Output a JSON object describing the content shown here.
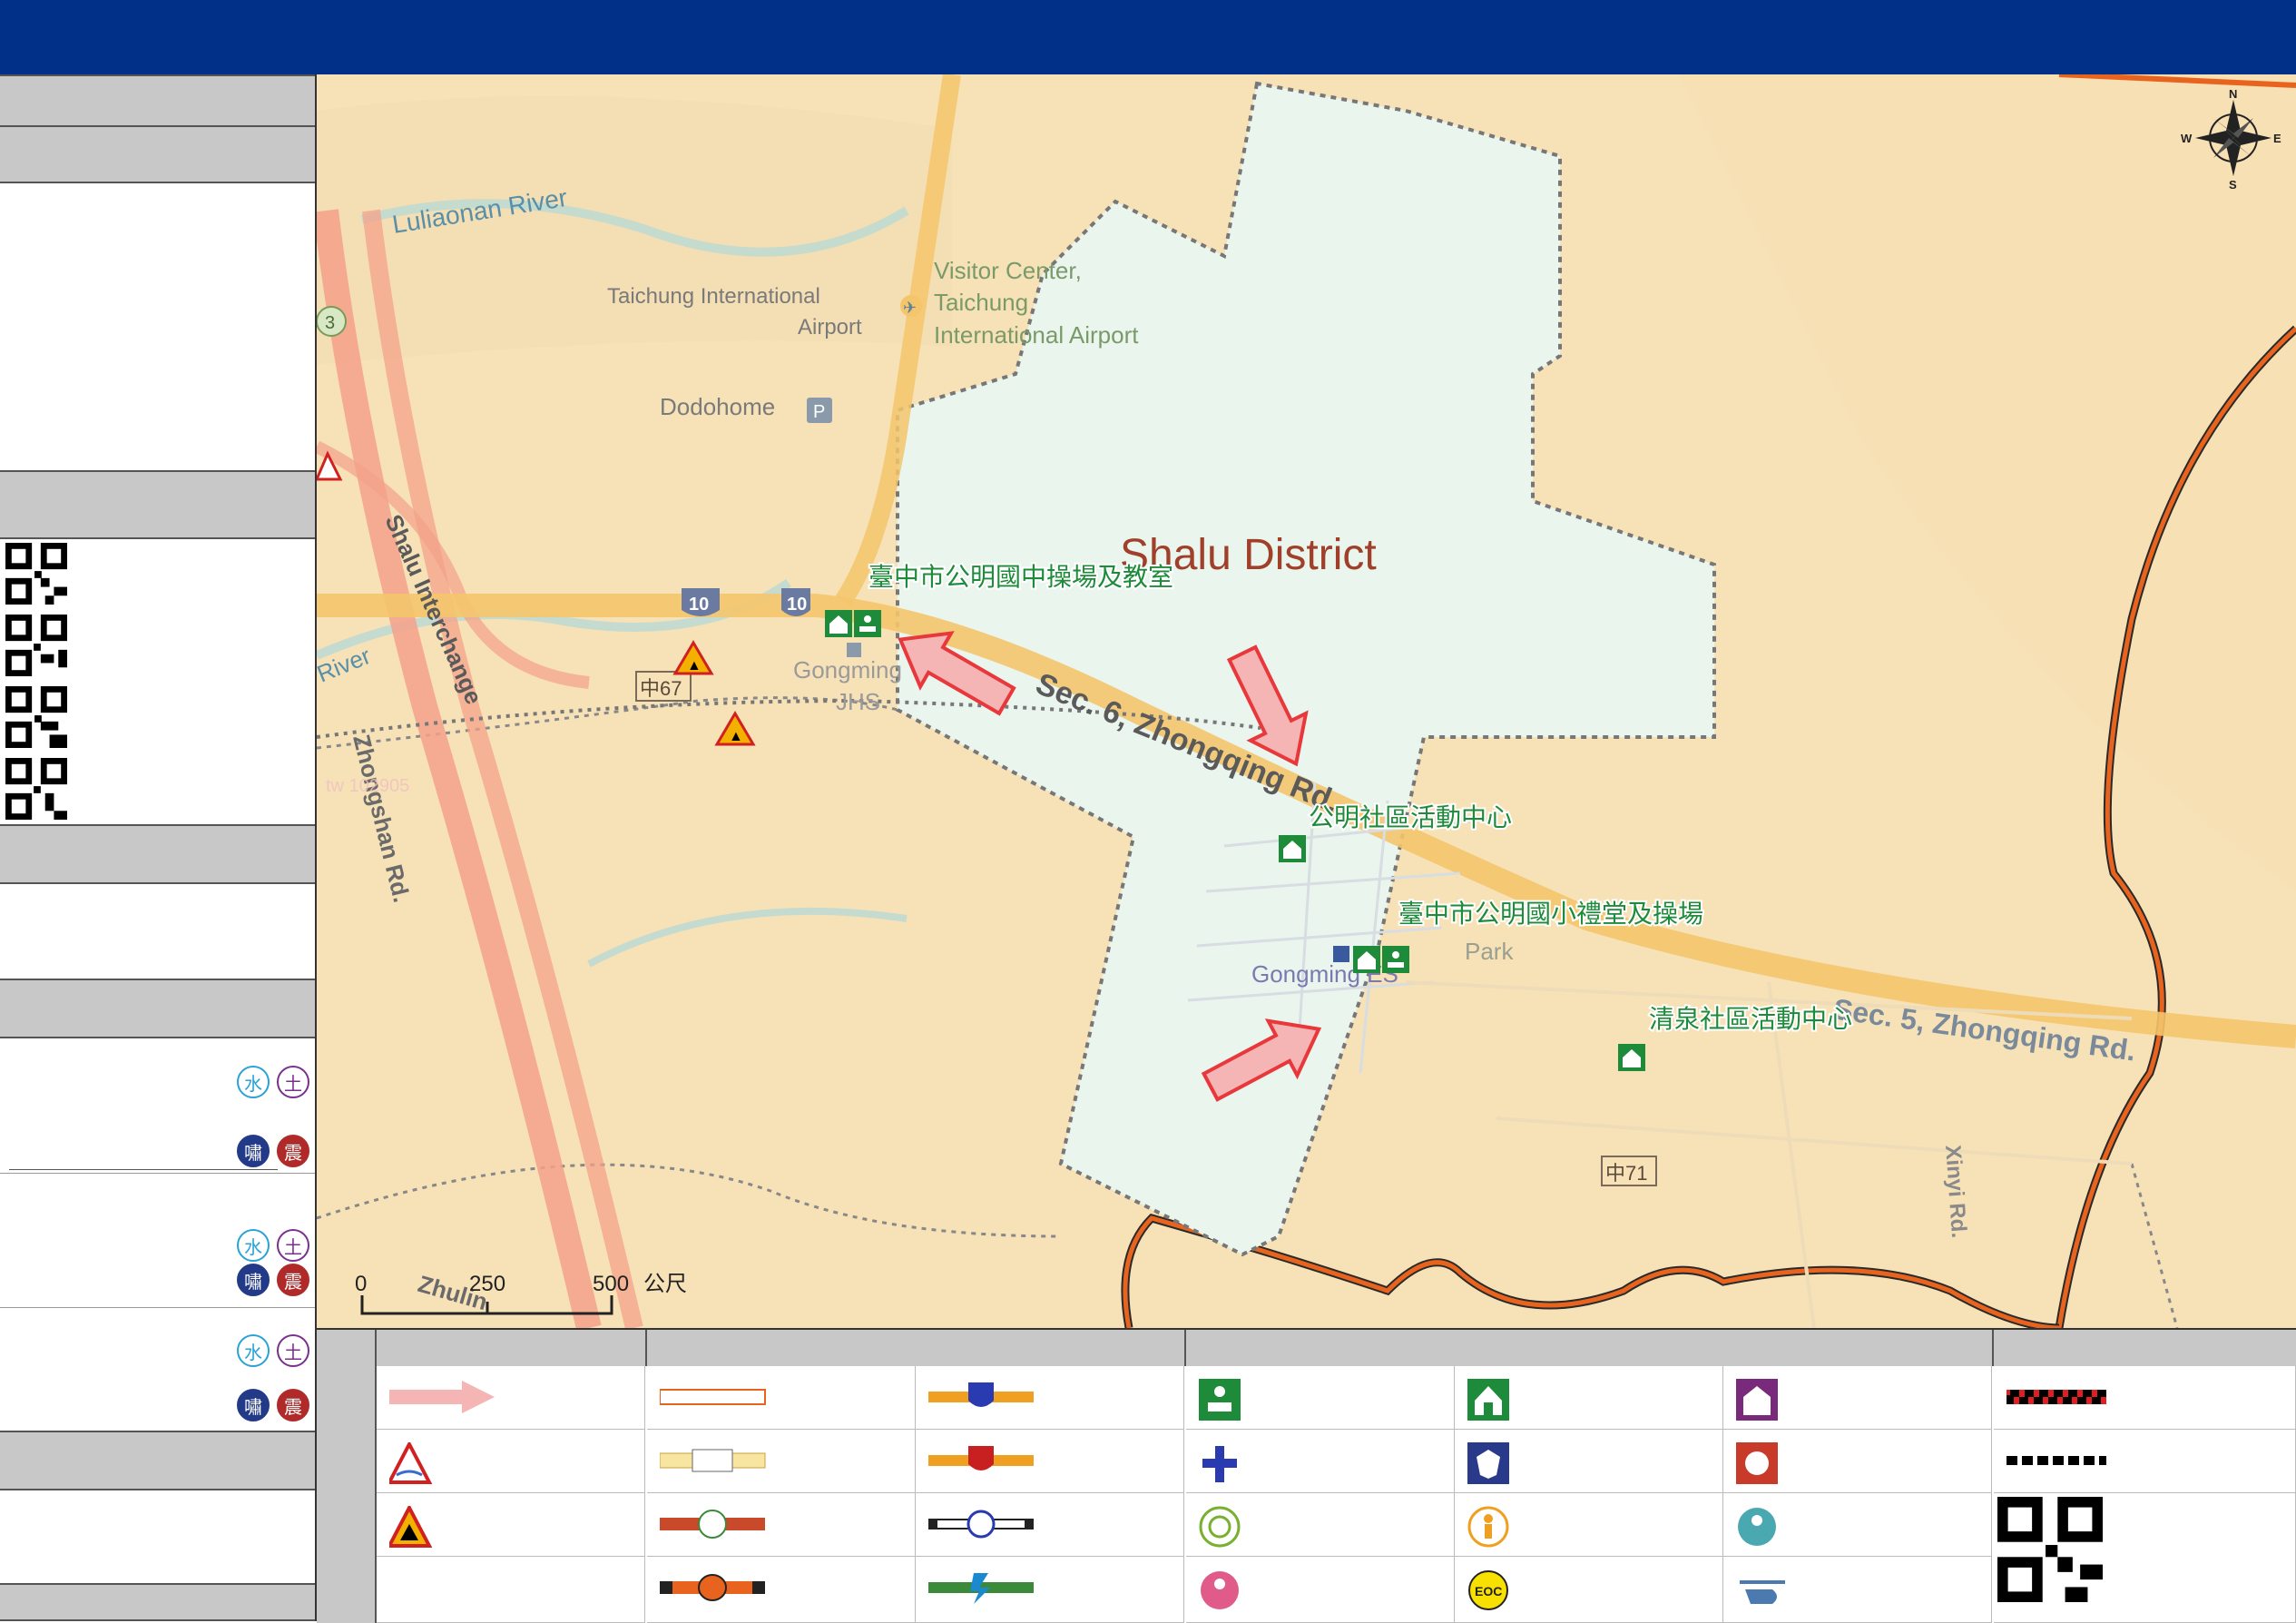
{
  "header": {
    "title": ""
  },
  "map": {
    "district_label": "Shalu District",
    "scale": {
      "tick0": "0",
      "tick1": "250",
      "tick2": "500",
      "unit": "公尺"
    },
    "compass": {
      "n": "N",
      "e": "E",
      "s": "S",
      "w": "W"
    },
    "shelters": {
      "s1": "臺中市公明國中操場及教室",
      "s2": "公明社區活動中心",
      "s3": "臺中市公明國小禮堂及操場",
      "s4": "清泉社區活動中心"
    },
    "base_labels": {
      "river1": "Luliaonan River",
      "river2": "River",
      "airport": "Taichung International",
      "airport2": "Airport",
      "visitor1": "Visitor Center,",
      "visitor2": "Taichung",
      "visitor3": "International Airport",
      "dodohome": "Dodohome",
      "road1": "Sec. 6, Zhongqing Rd.",
      "road2": "Sec. 5, Zhongqing Rd.",
      "interchange": "Shalu Interchange",
      "zhongshan": "Zhongshan Rd.",
      "xinyi": "Xinyi Rd.",
      "zhulin": "Zhulin",
      "jhs1": "Gongming",
      "jhs2": "JHS",
      "es": "Gongming ES",
      "park": "Park",
      "rt67": "中67",
      "rt71": "中71",
      "hw10": "10",
      "hw3": "3",
      "watermark": "tw 102905"
    }
  },
  "colors": {
    "header": "#003087",
    "shelter_green": "#1e8b3a",
    "arrow_red": "#e8383b",
    "boundary_orange": "#e8641e",
    "district_fill": "#eaf5ee",
    "base_map": "#f7e2b8"
  },
  "icons": [
    "compass-rose-icon",
    "evacuation-arrow-icon",
    "flood-warning-icon",
    "landslide-warning-icon",
    "shelter-outdoor-icon",
    "shelter-indoor-icon",
    "medical-icon",
    "police-icon",
    "fire-station-icon",
    "accessible-icon",
    "elderly-icon",
    "infant-icon",
    "family-support-icon",
    "eoc-icon",
    "helicopter-icon",
    "qr-code-icon"
  ],
  "sidebar": {
    "hazard_badges": {
      "water": "水",
      "earth": "土",
      "tsunami": "嘯",
      "quake": "震"
    }
  },
  "legend": {
    "eoc_label": "EOC"
  }
}
